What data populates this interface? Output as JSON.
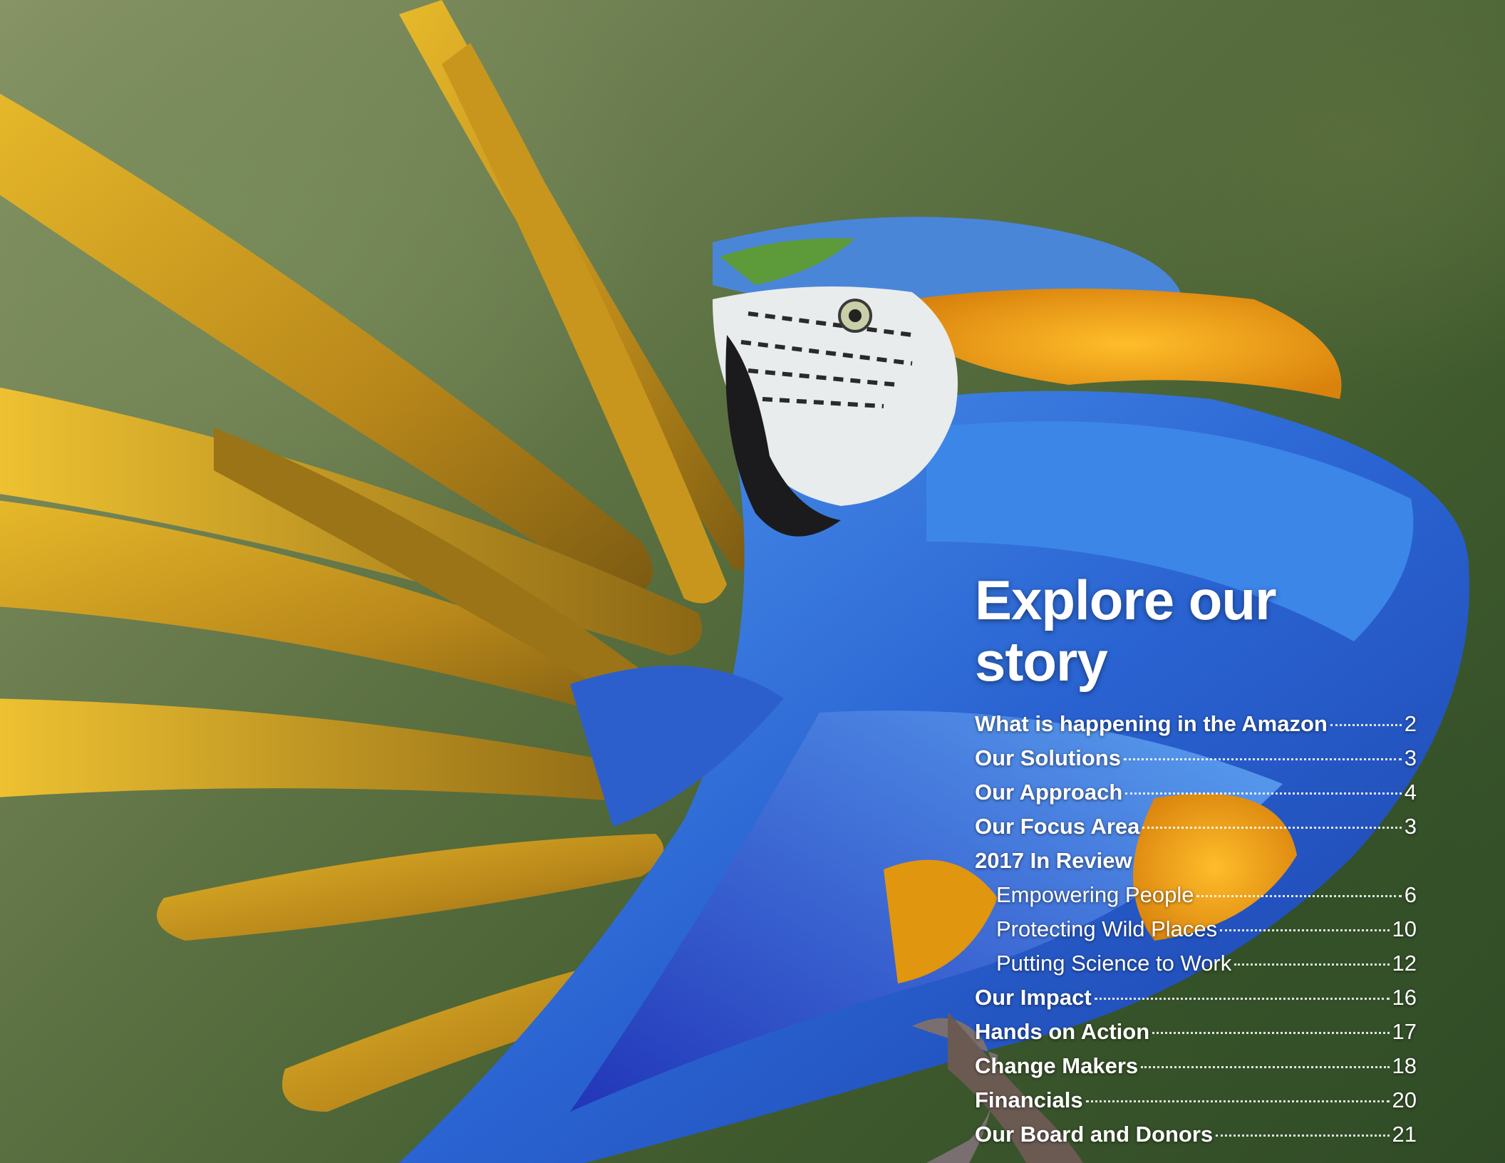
{
  "toc": {
    "title": "Explore our story",
    "entries": [
      {
        "label": "What is happening in the Amazon",
        "page": "2"
      },
      {
        "label": "Our Solutions",
        "page": "3"
      },
      {
        "label": "Our Approach",
        "page": "4"
      },
      {
        "label": "Our Focus Area",
        "page": "3"
      },
      {
        "label": "2017 In Review",
        "page": ""
      },
      {
        "label": "Empowering People",
        "page": "6"
      },
      {
        "label": "Protecting Wild Places",
        "page": "10"
      },
      {
        "label": "Putting Science to Work",
        "page": "12"
      },
      {
        "label": "Our Impact",
        "page": "16"
      },
      {
        "label": "Hands on Action",
        "page": "17"
      },
      {
        "label": "Change Makers",
        "page": "18"
      },
      {
        "label": "Financials",
        "page": "20"
      },
      {
        "label": "Our Board and Donors",
        "page": "21"
      }
    ]
  },
  "colors": {
    "feather_gold": "#c99a1c",
    "feather_blue": "#2f6fd6",
    "belly_orange": "#f2a51c",
    "background_green": "#4d6236"
  }
}
